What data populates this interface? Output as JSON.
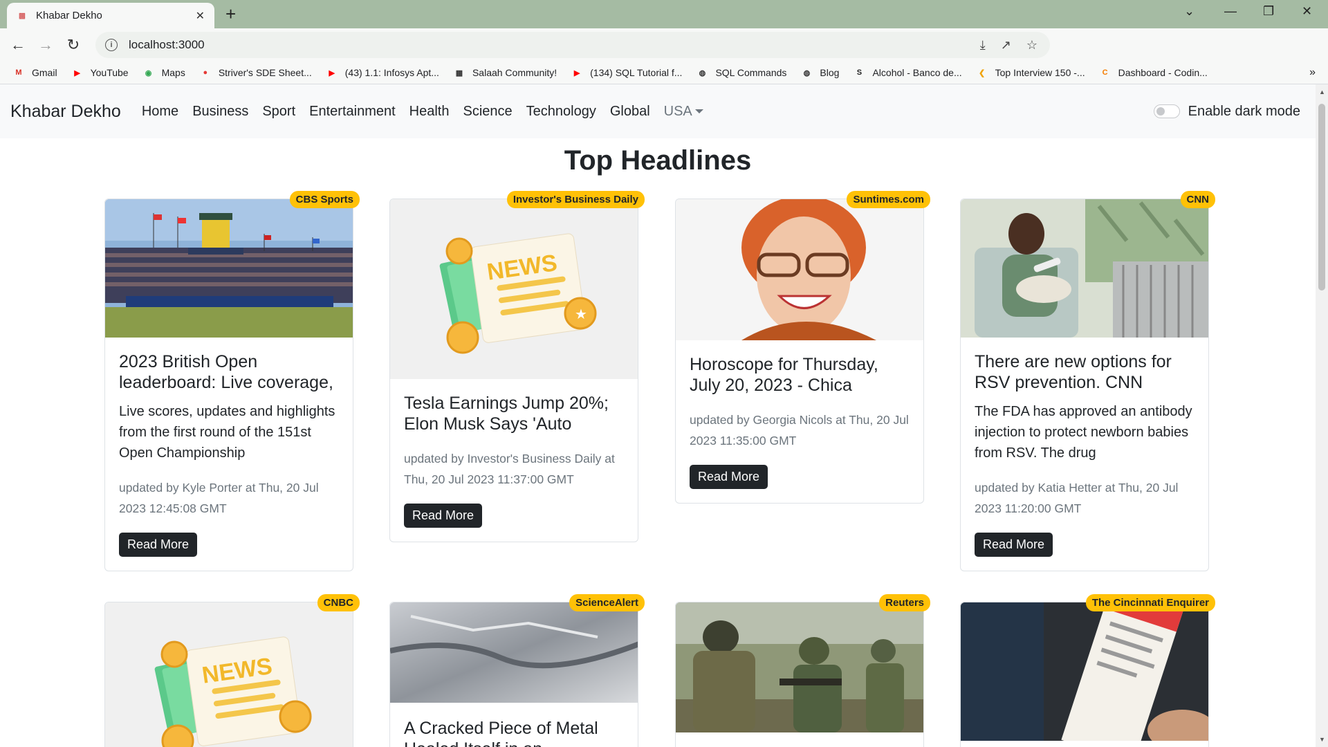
{
  "browser": {
    "tab_title": "Khabar Dekho",
    "url": "localhost:3000",
    "bookmarks": [
      {
        "label": "Gmail",
        "icon": "gmail-icon"
      },
      {
        "label": "YouTube",
        "icon": "youtube-icon"
      },
      {
        "label": "Maps",
        "icon": "maps-icon"
      },
      {
        "label": "Striver's SDE Sheet...",
        "icon": "tuf-icon"
      },
      {
        "label": "(43) 1.1: Infosys Apt...",
        "icon": "youtube-icon"
      },
      {
        "label": "Salaah Community!",
        "icon": "salaah-icon"
      },
      {
        "label": "(134) SQL Tutorial f...",
        "icon": "youtube-icon"
      },
      {
        "label": "SQL Commands",
        "icon": "globe-icon"
      },
      {
        "label": "Blog",
        "icon": "globe-icon"
      },
      {
        "label": "Alcohol - Banco de...",
        "icon": "s-icon"
      },
      {
        "label": "Top Interview 150 -...",
        "icon": "leetcode-icon"
      },
      {
        "label": "Dashboard - Codin...",
        "icon": "codingninjas-icon"
      }
    ]
  },
  "navbar": {
    "brand": "Khabar Dekho",
    "links": [
      "Home",
      "Business",
      "Sport",
      "Entertainment",
      "Health",
      "Science",
      "Technology",
      "Global"
    ],
    "country": "USA",
    "dark_mode_label": "Enable dark mode"
  },
  "page": {
    "heading": "Top Headlines"
  },
  "cards": [
    {
      "source": "CBS Sports",
      "title": "2023 British Open leaderboard: Live coverage,",
      "description": "Live scores, updates and highlights from the first round of the 151st Open Championship",
      "meta": "updated by Kyle Porter at Thu, 20 Jul 2023 12:45:08 GMT",
      "button": "Read More"
    },
    {
      "source": "Investor's Business Daily",
      "title": "Tesla Earnings Jump 20%; Elon Musk Says 'Auto",
      "description": "",
      "meta": "updated by Investor's Business Daily at Thu, 20 Jul 2023 11:37:00 GMT",
      "button": "Read More",
      "image_text": "NEWS"
    },
    {
      "source": "Suntimes.com",
      "title": "Horoscope for Thursday, July 20, 2023 - Chica",
      "description": "",
      "meta": "updated by Georgia Nicols at Thu, 20 Jul 2023 11:35:00 GMT",
      "button": "Read More"
    },
    {
      "source": "CNN",
      "title": "There are new options for RSV prevention. CNN",
      "description": "The FDA has approved an antibody injection to protect newborn babies from RSV. The drug",
      "meta": "updated by Katia Hetter at Thu, 20 Jul 2023 11:20:00 GMT",
      "button": "Read More"
    },
    {
      "source": "CNBC",
      "image_text": "NEWS"
    },
    {
      "source": "ScienceAlert",
      "title": "A Cracked Piece of Metal Healed Itself in an"
    },
    {
      "source": "Reuters"
    },
    {
      "source": "The Cincinnati Enquirer"
    }
  ]
}
